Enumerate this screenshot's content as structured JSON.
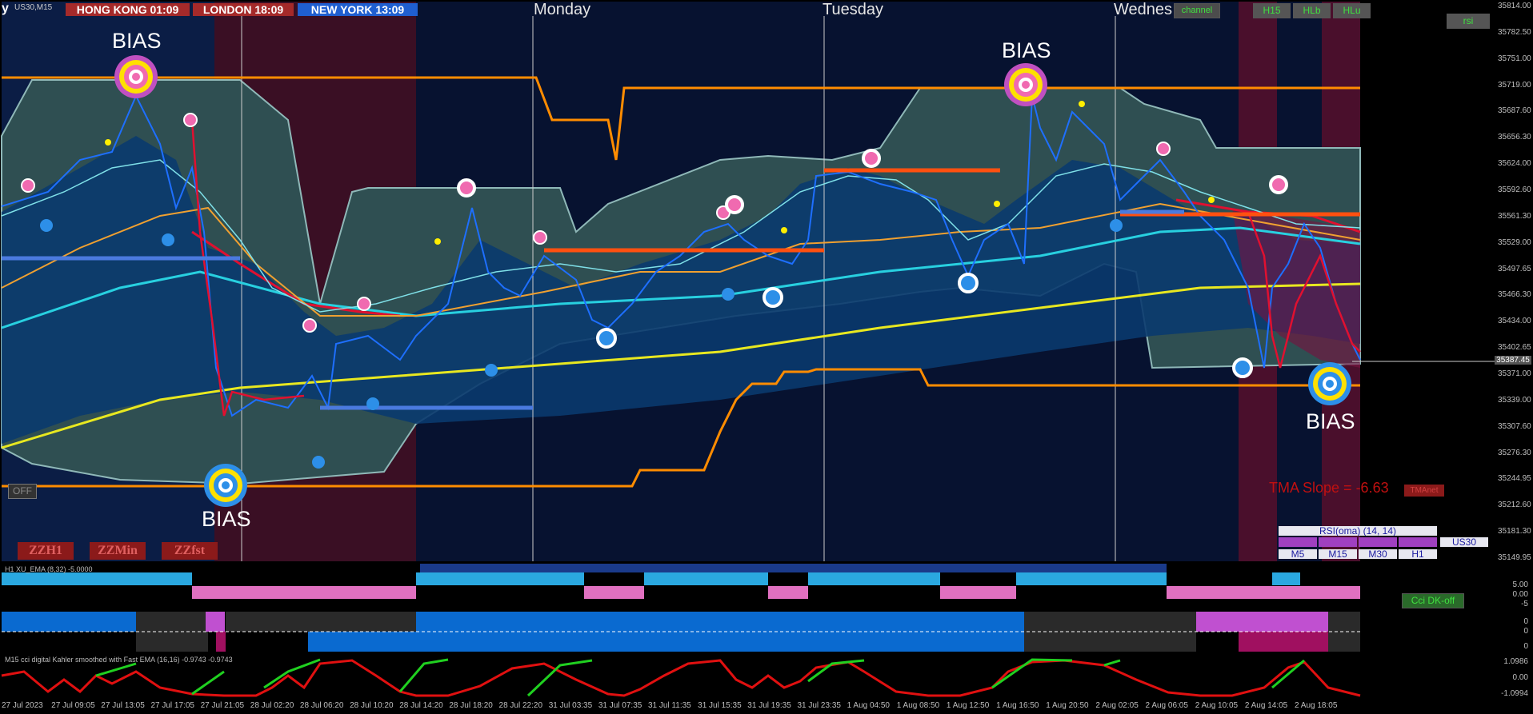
{
  "window": {
    "symbol_label": "US30,M15",
    "corner_glyph": "y"
  },
  "sessions": [
    {
      "label": "HONG KONG  01:09",
      "bg": "#a52a2a"
    },
    {
      "label": "LONDON   18:09",
      "bg": "#a52a2a"
    },
    {
      "label": "NEW YORK  13:09",
      "bg": "#1f5fd0"
    }
  ],
  "days": [
    "Monday",
    "Tuesday",
    "Wednes"
  ],
  "toolbar": {
    "channel": "channel",
    "h15": "H15",
    "hlb": "HLb",
    "hlu": "HLu",
    "rsi": "rsi"
  },
  "bias_labels": [
    "BIAS",
    "BIAS",
    "BIAS",
    "BIAS"
  ],
  "off_button": "OFF",
  "zigzag_buttons": [
    "ZZH1",
    "ZZMin",
    "ZZfst"
  ],
  "tma": {
    "label": "TMA Slope = ",
    "value": "-6.63",
    "button": "TMAnet"
  },
  "rsi_panel": {
    "title": "RSI(oma) (14, 14)",
    "symbol": "US30",
    "timeframes": [
      "M5",
      "M15",
      "M30",
      "H1"
    ]
  },
  "current_price": "35387.45",
  "price_axis": [
    "35814.00",
    "35782.50",
    "35751.00",
    "35719.00",
    "35687.60",
    "35656.30",
    "35624.00",
    "35592.60",
    "35561.30",
    "35529.00",
    "35497.65",
    "35466.30",
    "35434.00",
    "35402.65",
    "35371.00",
    "35339.00",
    "35307.60",
    "35276.30",
    "35244.95",
    "35212.60",
    "35181.30",
    "35149.95"
  ],
  "indicator1": {
    "label": "H1 XU_EMA (8,32) -5.0000",
    "axis": [
      "5.00",
      "0.00",
      "-5"
    ],
    "button": "Cci DK-off"
  },
  "indicator2": {
    "axis": [
      "0",
      "0",
      "0"
    ]
  },
  "indicator3": {
    "label": "M15 cci digital Kahler smoothed with Fast EMA (16,16) -0.9743 -0.9743",
    "axis": [
      "1.0986",
      "0.00",
      "-1.0994"
    ]
  },
  "time_axis": [
    "27 Jul 2023",
    "27 Jul 09:05",
    "27 Jul 13:05",
    "27 Jul 17:05",
    "27 Jul 21:05",
    "28 Jul 02:20",
    "28 Jul 06:20",
    "28 Jul 10:20",
    "28 Jul 14:20",
    "28 Jul 18:20",
    "28 Jul 22:20",
    "31 Jul 03:35",
    "31 Jul 07:35",
    "31 Jul 11:35",
    "31 Jul 15:35",
    "31 Jul 19:35",
    "31 Jul 23:35",
    "1 Aug 04:50",
    "1 Aug 08:50",
    "1 Aug 12:50",
    "1 Aug 16:50",
    "1 Aug 20:50",
    "2 Aug 02:05",
    "2 Aug 06:05",
    "2 Aug 10:05",
    "2 Aug 14:05",
    "2 Aug 18:05"
  ],
  "colors": {
    "bg": "#071230",
    "session_red": "#3a0f24",
    "band": "#2f4f52",
    "blue_fill": "#0a3a6e",
    "orange": "#ff8c00",
    "yellow": "#e8e820",
    "cyan": "#28d0e0",
    "red_line": "#e01030"
  }
}
